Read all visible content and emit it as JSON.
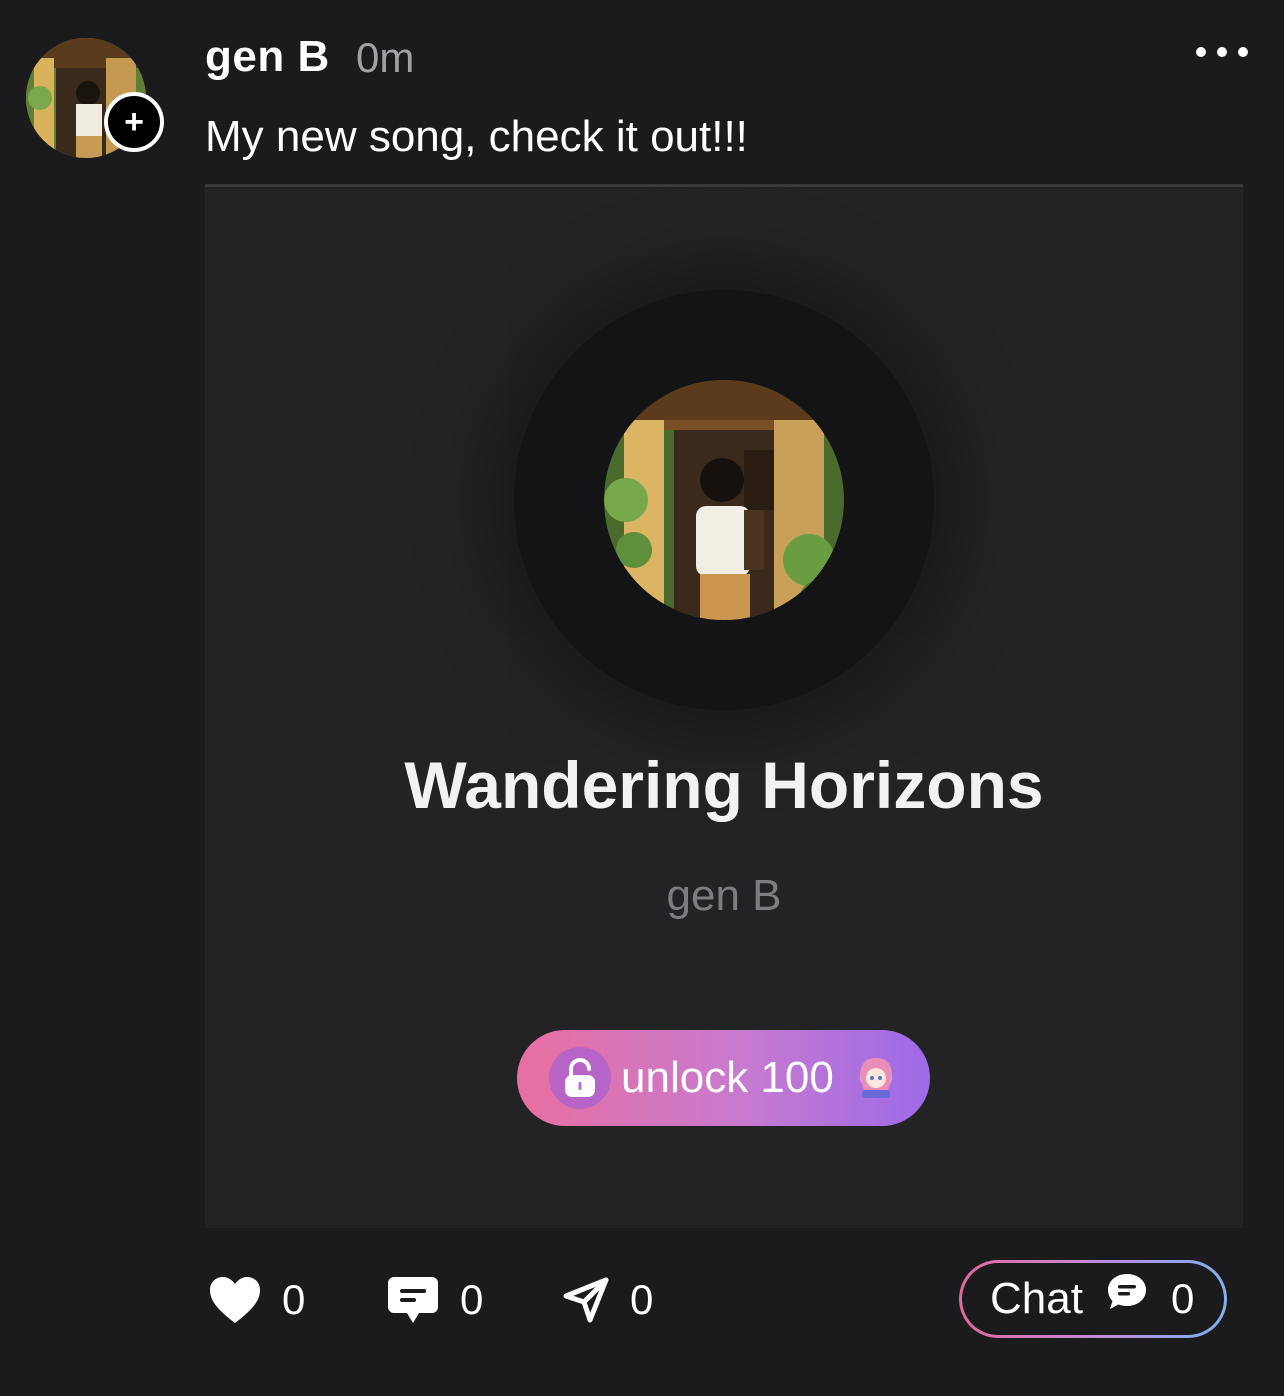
{
  "post": {
    "author": "gen B",
    "time": "0m",
    "caption": "My new song, check it out!!!",
    "follow_symbol": "+",
    "more_icon": "more-horizontal-icon"
  },
  "song": {
    "title": "Wandering Horizons",
    "artist": "gen B",
    "unlock_label": "unlock 100",
    "lock_icon": "lock-open-icon",
    "coin_icon": "wibu-coin-icon"
  },
  "actions": {
    "likes": "0",
    "comments": "0",
    "shares": "0",
    "chat_label": "Chat",
    "chat_count": "0"
  },
  "colors": {
    "background": "#1b1b1d",
    "card": "#232326",
    "unlock_gradient_start": "#e86fa0",
    "unlock_gradient_end": "#9d6ae8",
    "chat_border_start": "#e06a9a",
    "chat_border_end": "#7fb0f0"
  }
}
